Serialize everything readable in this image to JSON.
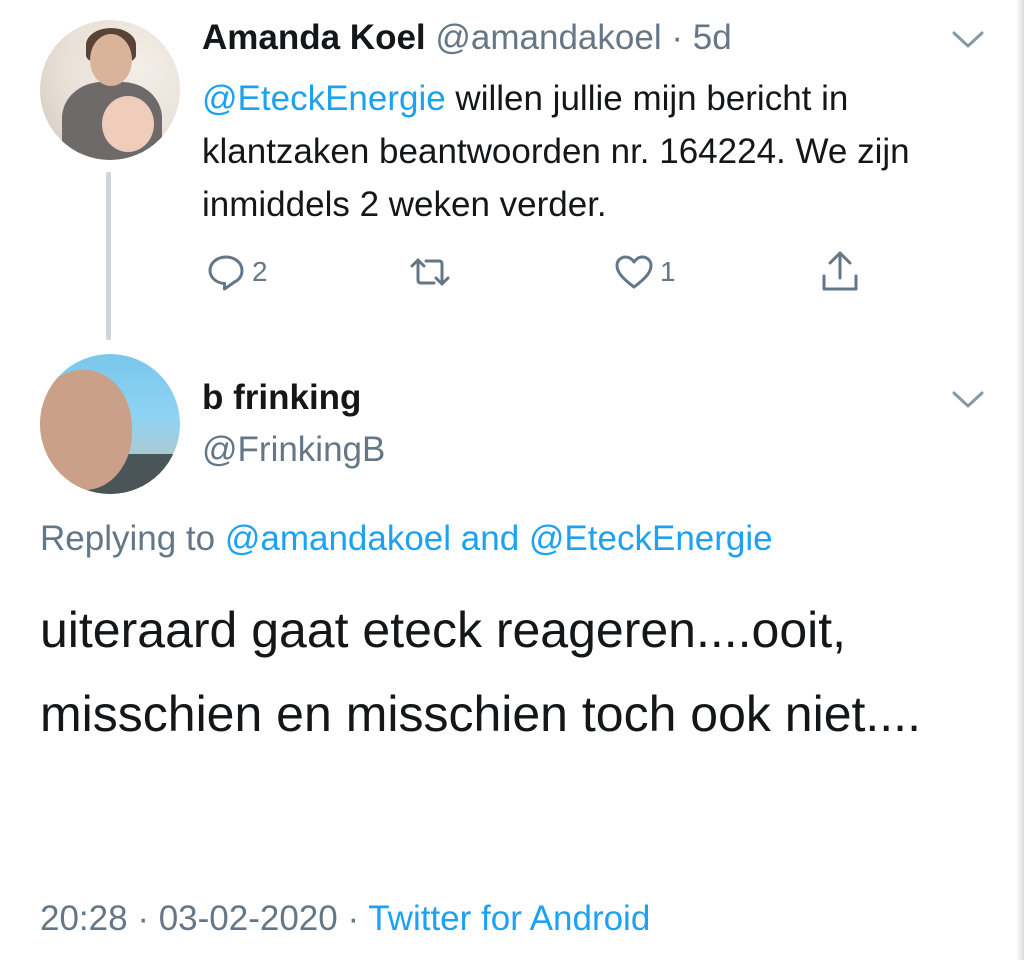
{
  "parent_tweet": {
    "author_name": "Amanda Koel",
    "author_handle": "@amandakoel",
    "separator": "·",
    "age": "5d",
    "mention": "@EteckEnergie",
    "text_after_mention": " willen jullie mijn bericht in klantzaken beantwoorden nr. 164224. We zijn inmiddels 2 weken verder.",
    "reply_count": "2",
    "retweet_count": "",
    "like_count": "1",
    "icons": [
      "reply-icon",
      "retweet-icon",
      "like-icon",
      "share-icon",
      "chevron-down-icon"
    ]
  },
  "reply_tweet": {
    "author_name": "b frinking",
    "author_handle": "@FrinkingB",
    "replying_prefix": "Replying to ",
    "replying_to_1": "@amandakoel",
    "replying_joiner": " and ",
    "replying_to_2": "@EteckEnergie",
    "text": "uiteraard gaat eteck reageren....ooit, misschien en misschien toch ook niet....",
    "time": "20:28",
    "separator": " · ",
    "date": "03-02-2020",
    "source": "Twitter for Android"
  },
  "colors": {
    "link": "#1da1f2",
    "muted": "#657786",
    "text": "#14171a",
    "thread_line": "#ccd6dd"
  }
}
